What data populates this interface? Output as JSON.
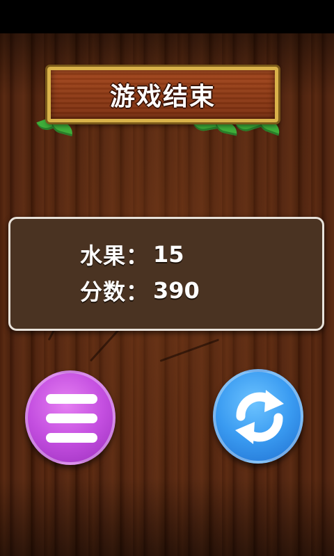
{
  "title": "游戏结束",
  "score": {
    "fruit_label": "水果：",
    "fruit_value": "15",
    "points_label": "分数：",
    "points_value": "390"
  },
  "buttons": {
    "menu_icon": "menu-icon",
    "restart_icon": "restart-icon"
  },
  "colors": {
    "menu_button": "#c44fe0",
    "restart_button": "#3a9bf1",
    "sign_border": "#d9b24a",
    "panel_bg": "#4a3322"
  }
}
